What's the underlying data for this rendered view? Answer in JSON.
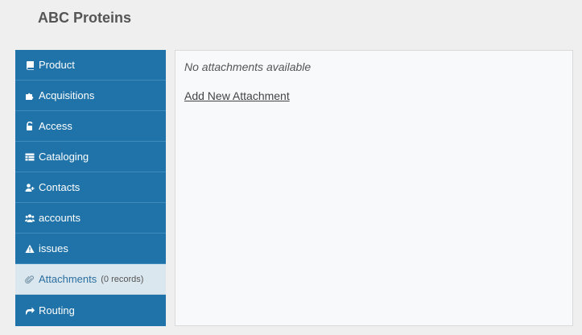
{
  "header": {
    "title": "ABC Proteins"
  },
  "sidebar": {
    "items": [
      {
        "label": "Product",
        "icon": "book-icon"
      },
      {
        "label": "Acquisitions",
        "icon": "puzzle-icon"
      },
      {
        "label": "Access",
        "icon": "unlock-icon"
      },
      {
        "label": "Cataloging",
        "icon": "table-icon"
      },
      {
        "label": "Contacts",
        "icon": "user-plus-icon"
      },
      {
        "label": "accounts",
        "icon": "users-icon"
      },
      {
        "label": "issues",
        "icon": "warning-icon"
      },
      {
        "label": "Attachments",
        "count": "(0 records)",
        "icon": "paperclip-icon",
        "active": true
      },
      {
        "label": "Routing",
        "icon": "share-icon"
      }
    ]
  },
  "main": {
    "empty_message": "No attachments available",
    "add_link": "Add New Attachment"
  },
  "colors": {
    "sidebar_bg": "#1f73a8",
    "sidebar_active_bg": "#dbe7ee",
    "page_bg": "#efefef",
    "content_bg": "#f8f9fb"
  }
}
